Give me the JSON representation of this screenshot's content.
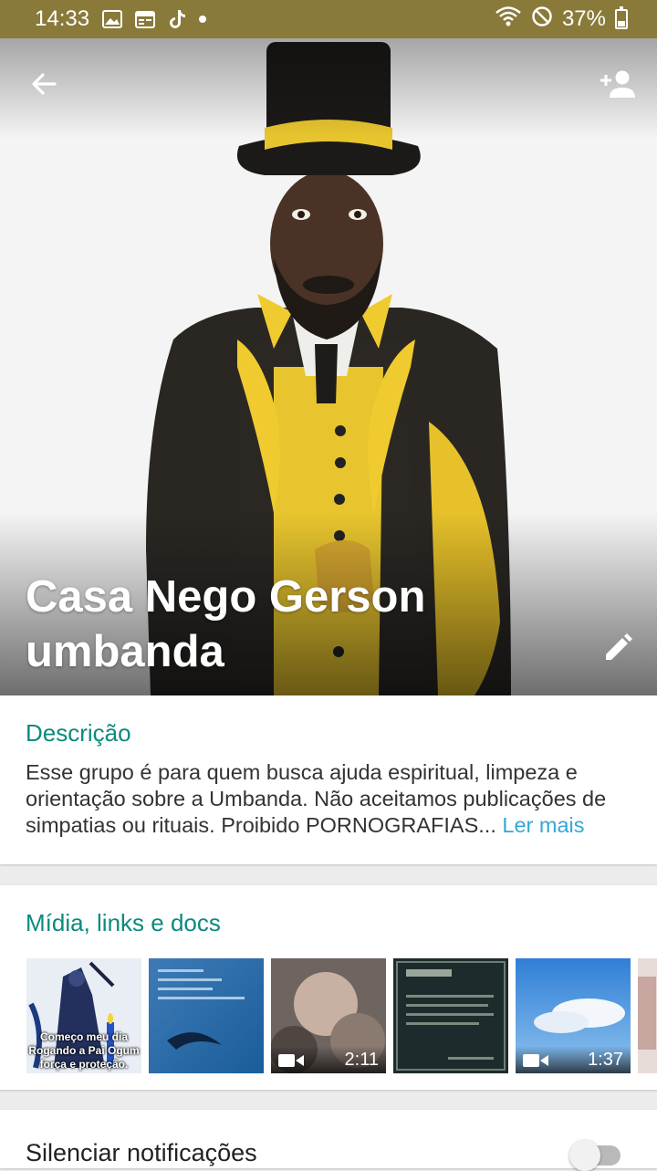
{
  "status_bar": {
    "time": "14:33",
    "left_icons": [
      "image-icon",
      "calendar-icon",
      "tiktok-icon",
      "dot-icon"
    ],
    "right_icons": [
      "wifi-icon",
      "do-not-disturb-icon",
      "battery-icon"
    ],
    "battery": "37%"
  },
  "header": {
    "title": "Casa Nego Gerson umbanda",
    "back_icon": "arrow-left-icon",
    "add_participant_icon": "person-add-icon",
    "edit_icon": "pencil-icon"
  },
  "description": {
    "heading": "Descrição",
    "text": "Esse grupo é para quem busca ajuda espiritual, limpeza e orientação sobre a Umbanda. Não aceitamos publicações de simpatias ou rituais. Proibido PORNOGRAFIAS...",
    "read_more": "Ler mais"
  },
  "media": {
    "heading": "Mídia, links e docs",
    "items": [
      {
        "kind": "image",
        "caption": "Começo meu dia Rogando a Pai Ogum força e proteção."
      },
      {
        "kind": "image",
        "caption": ""
      },
      {
        "kind": "video",
        "duration": "2:11"
      },
      {
        "kind": "image",
        "caption": ""
      },
      {
        "kind": "video",
        "duration": "1:37"
      }
    ]
  },
  "notifications": {
    "label": "Silenciar notificações",
    "muted": false
  },
  "colors": {
    "status_bar": "#8a7a3a",
    "accent": "#0b8a7d",
    "link": "#34a7d6"
  }
}
